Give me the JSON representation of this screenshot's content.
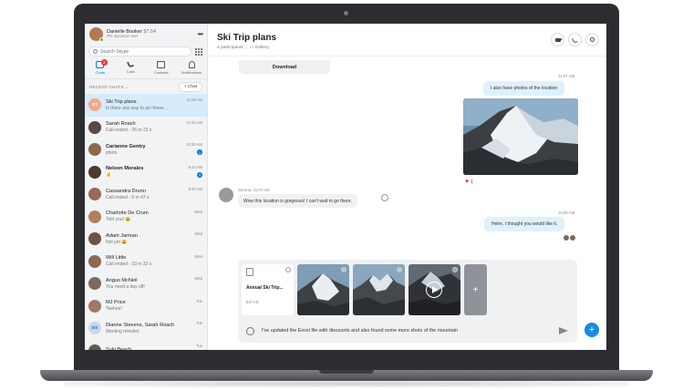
{
  "profile": {
    "name": "Danielle Booker",
    "balance": "$7.54",
    "mood": "Plz sponsor me!"
  },
  "search": {
    "placeholder": "Search Skype"
  },
  "nav": {
    "items": [
      {
        "label": "Chats",
        "badge": "2"
      },
      {
        "label": "Calls"
      },
      {
        "label": "Contacts"
      },
      {
        "label": "Notifications"
      }
    ]
  },
  "recent": {
    "label": "RECENT CHATS",
    "new_chat": "+ Chat"
  },
  "chats": [
    {
      "initials": "ST",
      "name": "Ski Trip plans",
      "message": "Is there any way to pin these ...",
      "time": "11:06 AM",
      "color": "#f2a98a",
      "selected": true
    },
    {
      "name": "Sarah Roach",
      "message": "Call ended - 26 m 23 s",
      "time": "10:31 AM",
      "color": "#5a4a42"
    },
    {
      "name": "Carianne Gentry",
      "message": "photo",
      "time": "10:30 AM",
      "count": "1",
      "bold": true,
      "color": "#8c6a50"
    },
    {
      "name": "Nelson Morales",
      "message": "✌",
      "time": "9:42 AM",
      "count": "4",
      "bold": true,
      "color": "#4a3a30"
    },
    {
      "name": "Cassandra Drunn",
      "message": "Call ended - 5 m 47 s",
      "time": "9:40 AM",
      "color": "#9a6a58"
    },
    {
      "name": "Charlotte De Crum",
      "message": "Told you! 😀",
      "time": "Wed",
      "color": "#b08060"
    },
    {
      "name": "Adam Jarman",
      "message": "Not yet 😀",
      "time": "Wed",
      "color": "#6a5448"
    },
    {
      "name": "Will Little",
      "message": "Call ended - 10 m 32 s",
      "time": "Wed",
      "color": "#8a6a52"
    },
    {
      "name": "Angus McNeil",
      "message": "You need a day off!",
      "time": "Wed",
      "color": "#7a6a60"
    },
    {
      "name": "MJ Price",
      "message": "Teehee!",
      "time": "Tue",
      "color": "#a07866"
    },
    {
      "initials": "DS",
      "name": "Dianne Stevens, Sarah Roach",
      "message": "Meeting minutes",
      "time": "Tue",
      "color": "#c9d8e6"
    },
    {
      "name": "Suki Beach",
      "message": "",
      "time": "Tue",
      "color": "#6a5a50"
    }
  ],
  "conversation": {
    "title": "Ski Trip plans",
    "participants": "4 participants",
    "gallery": "Gallery",
    "download": "Download",
    "messages": [
      {
        "time": "11:07 AM",
        "text": "I also have photos of the location"
      },
      {
        "reaction_count": "1"
      },
      {
        "sender_line": "Serena, 11:07 AM",
        "text": "Wow this location is gorgeous! I can't wait to go there."
      },
      {
        "time": "11:08 AM",
        "text": "Hehe, I thought you would like it."
      }
    ]
  },
  "composer": {
    "file_name": "Annual Ski Trip...",
    "file_size": "847 KB",
    "text": "I've updated the Excel file with discounts and also found some more shots of the mountain"
  },
  "colors": {
    "accent": "#0078d4",
    "bubble_me": "#dff1fd",
    "sidebar": "#f2f3f5"
  }
}
